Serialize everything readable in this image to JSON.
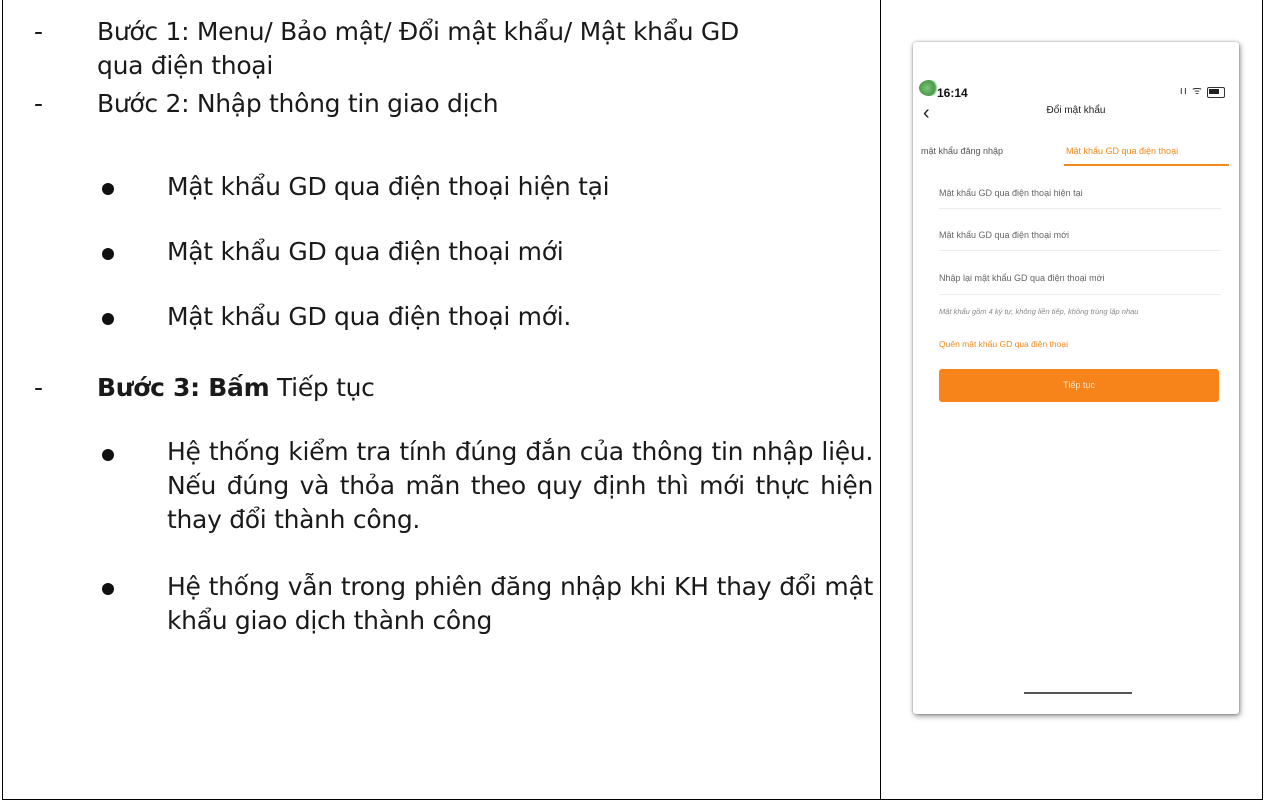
{
  "left": {
    "step1_line1": "Bước 1: Menu/ Bảo mật/ Đổi mật khẩu/ Mật khẩu GD",
    "step1_line2": "qua điện thoại",
    "step2": "Bước 2: Nhập thông tin giao dịch",
    "step2_bullets": [
      "Mật khẩu GD qua điện thoại hiện tại",
      "Mật khẩu GD qua điện thoại mới",
      "Mật khẩu GD qua điện thoại mới."
    ],
    "step3_bold": "Bước 3: Bấm",
    "step3_rest": " Tiếp tục",
    "step3_bullets": [
      "Hệ thống kiểm tra tính đúng đắn của thông tin nhập liệu. Nếu đúng và thỏa mãn theo quy định thì mới thực hiện thay đổi thành công.",
      "Hệ thống vẫn trong phiên đăng nhập khi KH thay đổi mật khẩu giao dịch thành công"
    ],
    "dash": "-"
  },
  "phone": {
    "time": "16:14",
    "status_icons": "ıı ᯤ",
    "back_glyph": "‹",
    "title": "Đổi mật khẩu",
    "tab_login": "mật khẩu đăng nhập",
    "tab_phone": "Mật khẩu GD qua điện thoại",
    "field_current": "Mật khẩu GD qua điện thoại hiện tại",
    "field_new": "Mật khẩu GD qua điện thoại mới",
    "field_confirm": "Nhập lại mật khẩu GD qua điện thoại mới",
    "hint": "Mật khẩu gồm 4 ký tự, không liền tiếp, không trùng lặp nhau",
    "forgot": "Quên mật khẩu GD qua điện thoại",
    "continue_label": "Tiếp tục",
    "accent_color": "#f7841a"
  }
}
